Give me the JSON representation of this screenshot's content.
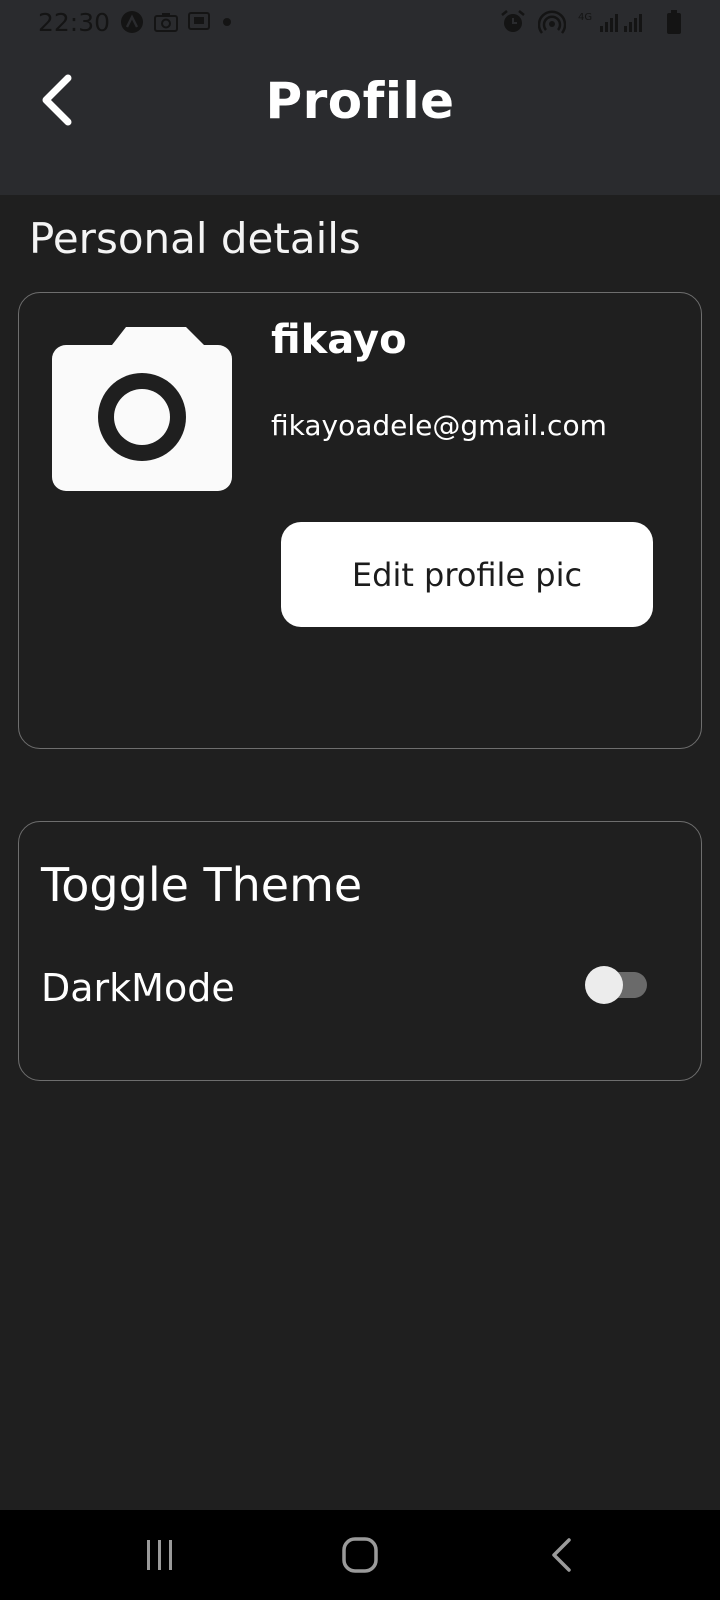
{
  "status_bar": {
    "time": "22:30",
    "network_label": "4G"
  },
  "app_bar": {
    "title": "Profile"
  },
  "personal_details": {
    "heading": "Personal details",
    "name": "fikayo",
    "email": "fikayoadele@gmail.com",
    "edit_button_label": "Edit profile pic"
  },
  "theme": {
    "heading": "Toggle Theme",
    "dark_mode_label": "DarkMode",
    "dark_mode_enabled": false
  },
  "colors": {
    "background": "#1f1f1f",
    "app_bar": "#2a2b2e",
    "card_border": "#6e6e6e",
    "button_bg": "#ffffff",
    "toggle_track": "#6a6a6a",
    "nav_bar": "#000000"
  },
  "icons": {
    "back": "chevron-left-icon",
    "avatar": "camera-icon",
    "nav_recents": "recent-apps-icon",
    "nav_home": "home-icon",
    "nav_back": "back-icon"
  }
}
